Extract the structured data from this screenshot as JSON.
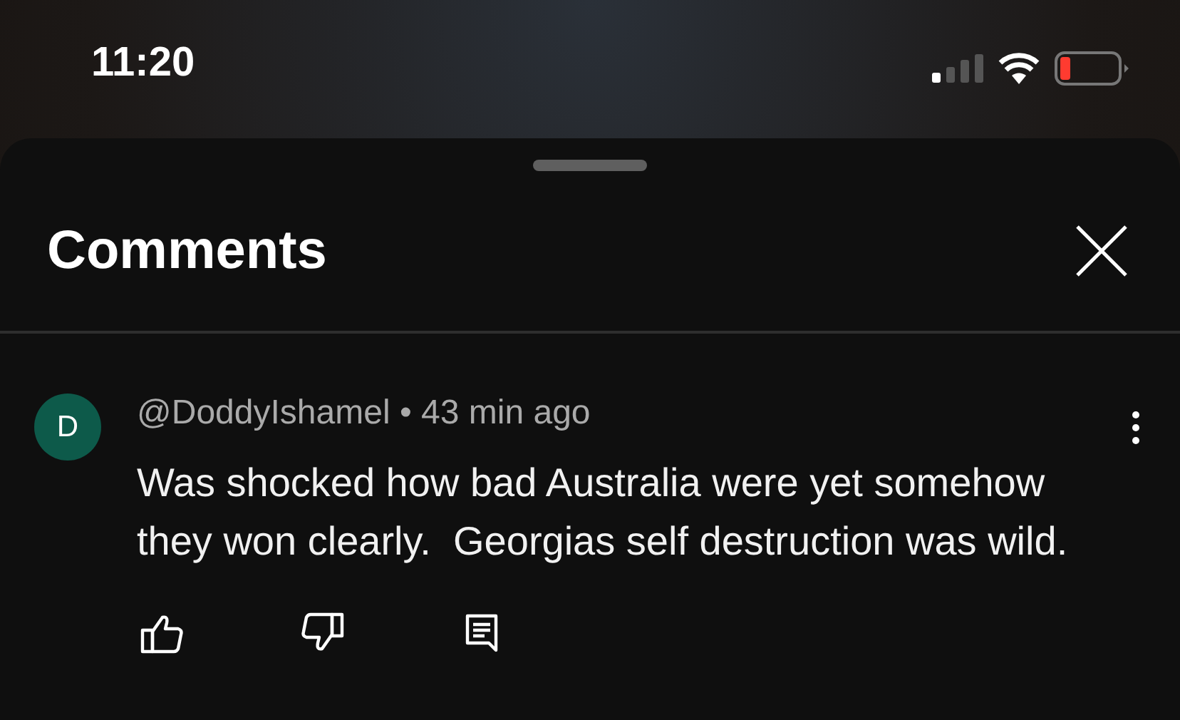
{
  "status_bar": {
    "time": "11:20"
  },
  "sheet": {
    "title": "Comments"
  },
  "comments": [
    {
      "avatar": "D",
      "author": "@DoddyIshamel",
      "separator": "•",
      "age": "43 min ago",
      "text": "Was shocked how bad Australia were yet somehow they won clearly.  Georgias self destruction was wild."
    }
  ]
}
